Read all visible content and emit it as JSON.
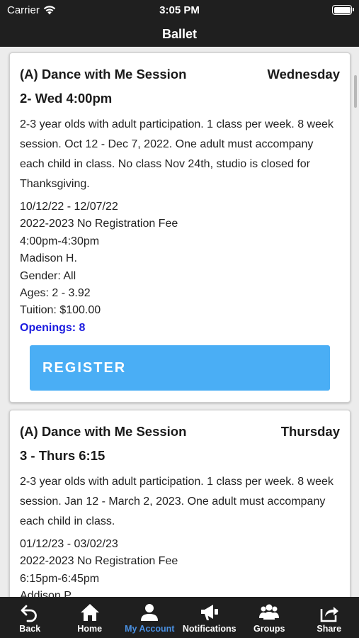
{
  "status_bar": {
    "carrier": "Carrier",
    "time": "3:05 PM",
    "icons": [
      "wifi-icon",
      "battery-icon"
    ]
  },
  "nav": {
    "title": "Ballet"
  },
  "cards": [
    {
      "title": "(A) Dance with Me Session",
      "day": "Wednesday",
      "subtitle": "2- Wed 4:00pm",
      "description": "2-3 year olds with adult participation. 1 class per week. 8 week session. Oct 12 - Dec 7, 2022. One adult must accompany each child in class. No class Nov 24th, studio is closed for Thanksgiving.",
      "dates": "10/12/22 - 12/07/22",
      "fee": "2022-2023 No Registration Fee",
      "time": "4:00pm-4:30pm",
      "instructor": "Madison H.",
      "gender": "Gender: All",
      "ages": "Ages: 2 - 3.92",
      "tuition": "Tuition: $100.00",
      "openings": "Openings: 8",
      "register_label": "REGISTER"
    },
    {
      "title": "(A) Dance with Me Session",
      "day": "Thursday",
      "subtitle": "3 - Thurs 6:15",
      "description": "2-3 year olds with adult participation. 1 class per week. 8 week session. Jan 12 - March 2, 2023. One adult must accompany each child in class.",
      "dates": "01/12/23 - 03/02/23",
      "fee": "2022-2023 No Registration Fee",
      "time": "6:15pm-6:45pm",
      "instructor": "Addison P."
    }
  ],
  "tabs": [
    {
      "label": "Back",
      "icon": "back-icon"
    },
    {
      "label": "Home",
      "icon": "home-icon"
    },
    {
      "label": "My Account",
      "icon": "account-icon",
      "active": true
    },
    {
      "label": "Notifications",
      "icon": "megaphone-icon"
    },
    {
      "label": "Groups",
      "icon": "groups-icon"
    },
    {
      "label": "Share",
      "icon": "share-icon"
    }
  ],
  "colors": {
    "bars": "#1f1f1f",
    "register_button": "#4aaef5",
    "openings_text": "#1a1adf",
    "active_tab": "#4a90e2"
  }
}
